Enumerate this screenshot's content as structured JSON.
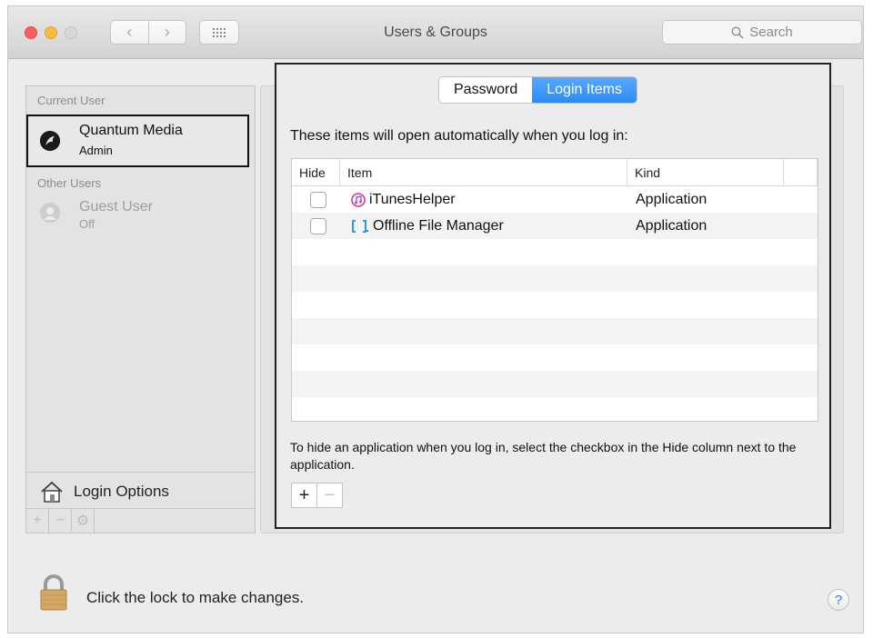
{
  "window": {
    "title": "Users & Groups"
  },
  "toolbar": {
    "search_placeholder": "Search"
  },
  "sidebar": {
    "current_user_heading": "Current User",
    "current_user": {
      "name": "Quantum Media",
      "role": "Admin"
    },
    "other_users_heading": "Other Users",
    "other_users": [
      {
        "name": "Guest User",
        "status": "Off"
      }
    ],
    "login_options_label": "Login Options"
  },
  "tabs": {
    "password": "Password",
    "login_items": "Login Items",
    "selected": "Login Items"
  },
  "login_items": {
    "intro": "These items will open automatically when you log in:",
    "columns": {
      "hide": "Hide",
      "item": "Item",
      "kind": "Kind"
    },
    "rows": [
      {
        "hide": false,
        "icon": "itunes-icon",
        "item": "iTunesHelper",
        "kind": "Application"
      },
      {
        "hide": false,
        "icon": "offline-file-manager-icon",
        "item": "Offline File Manager",
        "kind": "Application"
      }
    ],
    "help_text": "To hide an application when you log in, select the checkbox in the Hide column next to the application.",
    "add_label": "+",
    "remove_label": "−"
  },
  "footer": {
    "lock_text": "Click the lock to make changes.",
    "help_label": "?"
  },
  "colors": {
    "accent": "#2a8bf5",
    "window_bg": "#ececec"
  }
}
